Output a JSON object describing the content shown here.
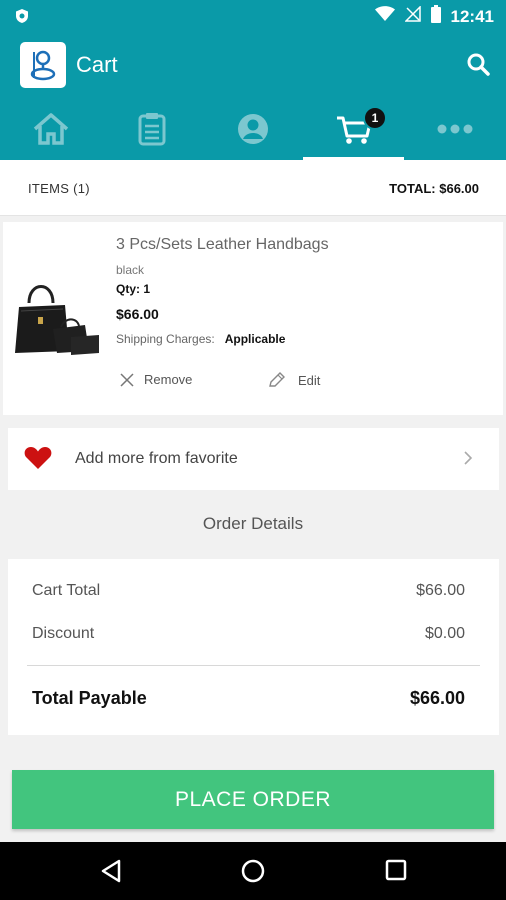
{
  "status_bar": {
    "time": "12:41"
  },
  "header": {
    "title": "Cart"
  },
  "tabs": {
    "cart_badge": "1"
  },
  "summary": {
    "items_label": "ITEMS (1)",
    "total_label": "TOTAL: $66.00"
  },
  "product": {
    "name": "3 Pcs/Sets Leather Handbags",
    "color": "black",
    "qty": "Qty: 1",
    "price": "$66.00",
    "shipping_label": "Shipping Charges:",
    "shipping_value": "Applicable",
    "remove_label": "Remove",
    "edit_label": "Edit"
  },
  "favorite": {
    "label": "Add more from favorite"
  },
  "order_details": {
    "title": "Order Details",
    "cart_total_label": "Cart Total",
    "cart_total_value": "$66.00",
    "discount_label": "Discount",
    "discount_value": "$0.00",
    "total_payable_label": "Total Payable",
    "total_payable_value": "$66.00"
  },
  "place_order_label": "PLACE ORDER",
  "colors": {
    "primary": "#0a9aa8",
    "button": "#42c57e",
    "heart": "#cc1111"
  }
}
